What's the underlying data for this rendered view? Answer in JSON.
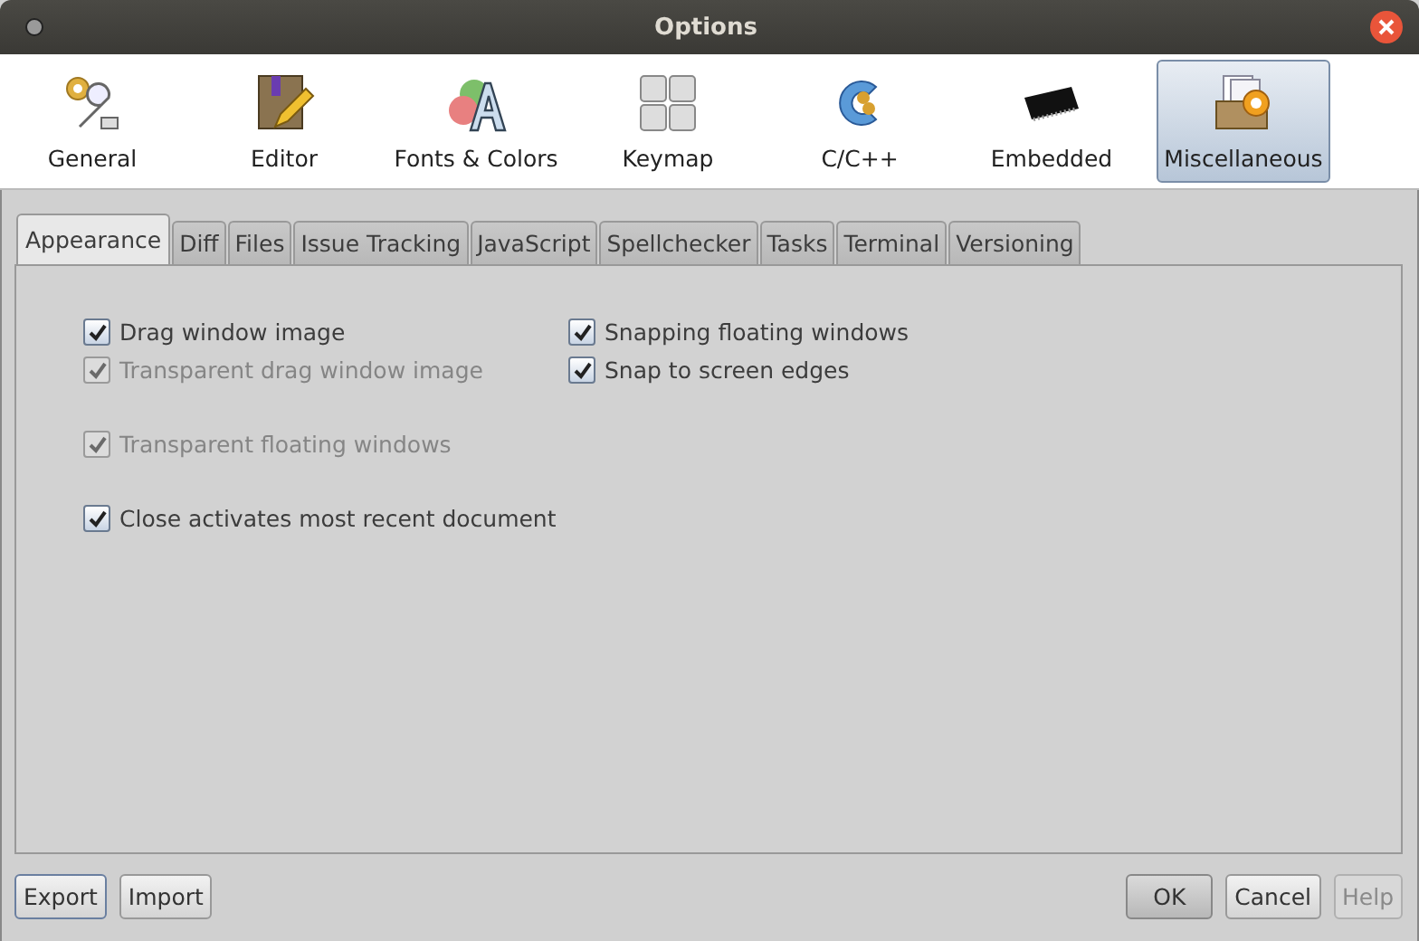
{
  "window": {
    "title": "Options"
  },
  "categories": [
    {
      "label": "General",
      "kind": "general",
      "selected": false
    },
    {
      "label": "Editor",
      "kind": "editor",
      "selected": false
    },
    {
      "label": "Fonts & Colors",
      "kind": "fonts",
      "selected": false
    },
    {
      "label": "Keymap",
      "kind": "keymap",
      "selected": false
    },
    {
      "label": "C/C++",
      "kind": "cpp",
      "selected": false
    },
    {
      "label": "Embedded",
      "kind": "chip",
      "selected": false
    },
    {
      "label": "Miscellaneous",
      "kind": "misc",
      "selected": true
    }
  ],
  "tabs": [
    {
      "label": "Appearance",
      "selected": true
    },
    {
      "label": "Diff",
      "selected": false
    },
    {
      "label": "Files",
      "selected": false
    },
    {
      "label": "Issue Tracking",
      "selected": false
    },
    {
      "label": "JavaScript",
      "selected": false
    },
    {
      "label": "Spellchecker",
      "selected": false
    },
    {
      "label": "Tasks",
      "selected": false
    },
    {
      "label": "Terminal",
      "selected": false
    },
    {
      "label": "Versioning",
      "selected": false
    }
  ],
  "left_options": [
    {
      "label": "Drag window image",
      "checked": true,
      "disabled": false
    },
    {
      "label": "Transparent drag window image",
      "checked": true,
      "disabled": true
    },
    {
      "label": "Transparent floating windows",
      "checked": true,
      "disabled": true
    },
    {
      "label": "Close activates most recent document",
      "checked": true,
      "disabled": false
    }
  ],
  "right_options": [
    {
      "label": "Snapping floating windows",
      "checked": true,
      "disabled": false
    },
    {
      "label": "Snap to screen edges",
      "checked": true,
      "disabled": false
    }
  ],
  "left_buttons": [
    {
      "label": "Export",
      "disabled": false
    },
    {
      "label": "Import",
      "disabled": false
    }
  ],
  "right_buttons": [
    {
      "label": "OK",
      "disabled": false
    },
    {
      "label": "Cancel",
      "disabled": false
    },
    {
      "label": "Help",
      "disabled": true
    }
  ]
}
